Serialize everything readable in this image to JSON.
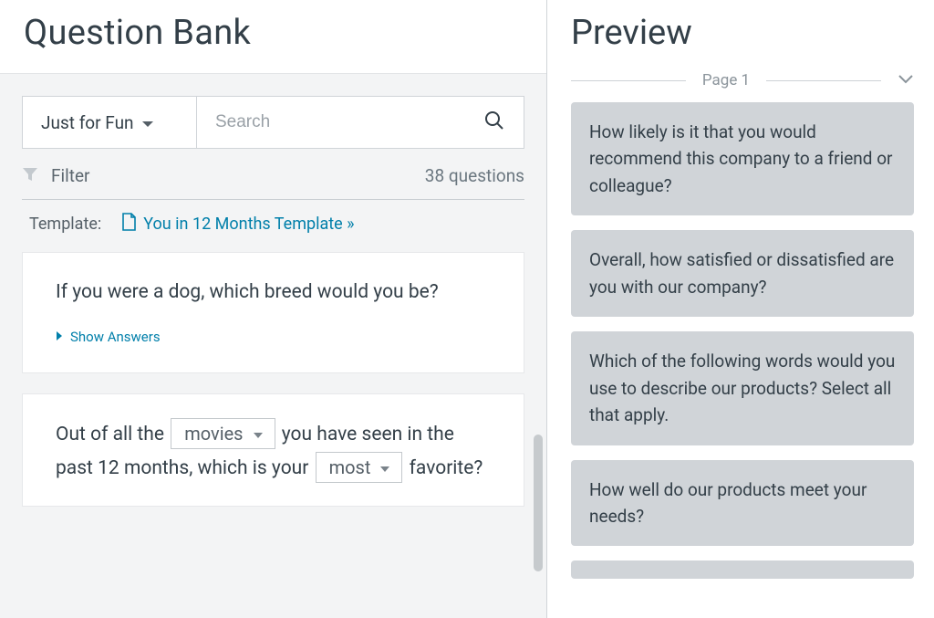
{
  "left": {
    "title": "Question Bank",
    "category_label": "Just for Fun",
    "search_placeholder": "Search",
    "filter_label": "Filter",
    "count_text": "38 questions",
    "template_label": "Template:",
    "template_link": "You in 12 Months Template »",
    "questions": [
      {
        "text": "If you were a dog, which breed would you be?",
        "show_answers": "Show Answers"
      },
      {
        "prefix": "Out of all the ",
        "dd1": "movies",
        "mid": " you have seen in the past 12 months, which is your ",
        "dd2": "most",
        "suffix": " favorite?"
      }
    ]
  },
  "right": {
    "title": "Preview",
    "page_label": "Page 1",
    "cards": [
      "How likely is it that you would recommend this company to a friend or colleague?",
      "Overall, how satisfied or dissatisfied are you with our company?",
      "Which of the following words would you use to describe our products? Select all that apply.",
      "How well do our products meet your needs?"
    ]
  }
}
